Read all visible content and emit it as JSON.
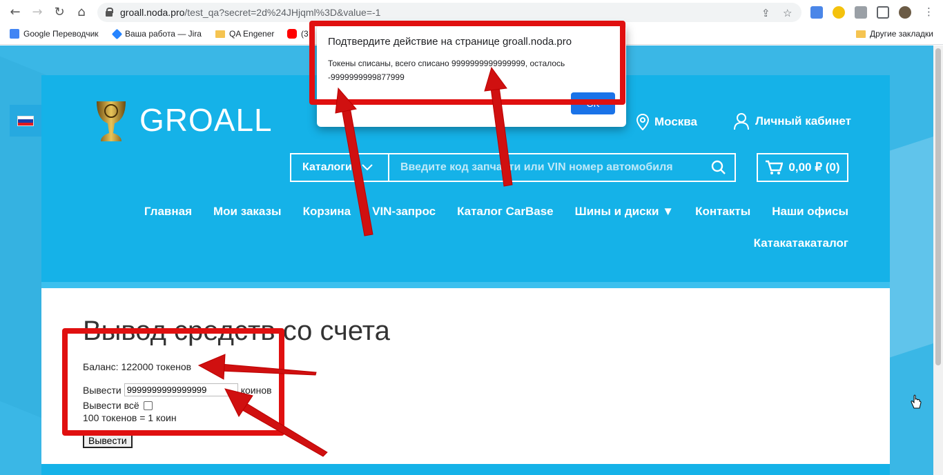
{
  "browser": {
    "url_host": "groall.noda.pro",
    "url_path": "/test_qa?secret=2d%24JHjqml%3D&value=-1",
    "bookmarks": [
      {
        "label": "Google Переводчик"
      },
      {
        "label": "Ваша работа — Jira"
      },
      {
        "label": "QA Engener"
      },
      {
        "label": "(3"
      }
    ],
    "other_bookmarks": "Другие закладки"
  },
  "site": {
    "logo": "GROALL",
    "city": "Москва",
    "cabinet": "Личный кабинет",
    "catalogs_label": "Каталоги",
    "search_placeholder": "Введите код запчасти или VIN номер автомобиля",
    "cart": "0,00 ₽ (0)",
    "menu": [
      "Главная",
      "Мои заказы",
      "Корзина",
      "VIN-запрос",
      "Каталог CarBase",
      "Шины и диски ▼",
      "Контакты",
      "Наши офисы"
    ],
    "menu_extra": "Катакатакаталог"
  },
  "form": {
    "title": "Вывод средств со счета",
    "balance": "Баланс: 122000 токенов",
    "withdraw_label": "Вывести",
    "withdraw_value": "9999999999999999",
    "unit": "коинов",
    "withdraw_all": "Вывести всё",
    "rate": "100 токенов = 1 коин",
    "submit": "Вывести"
  },
  "dialog": {
    "title": "Подтвердите действие на странице groall.noda.pro",
    "line1": "Токены списаны, всего списано 9999999999999999, осталось",
    "line2": "-9999999999877999",
    "ok": "OK"
  },
  "colors": {
    "brand_blue": "#15b2e8",
    "annotation_red": "#e01010"
  }
}
